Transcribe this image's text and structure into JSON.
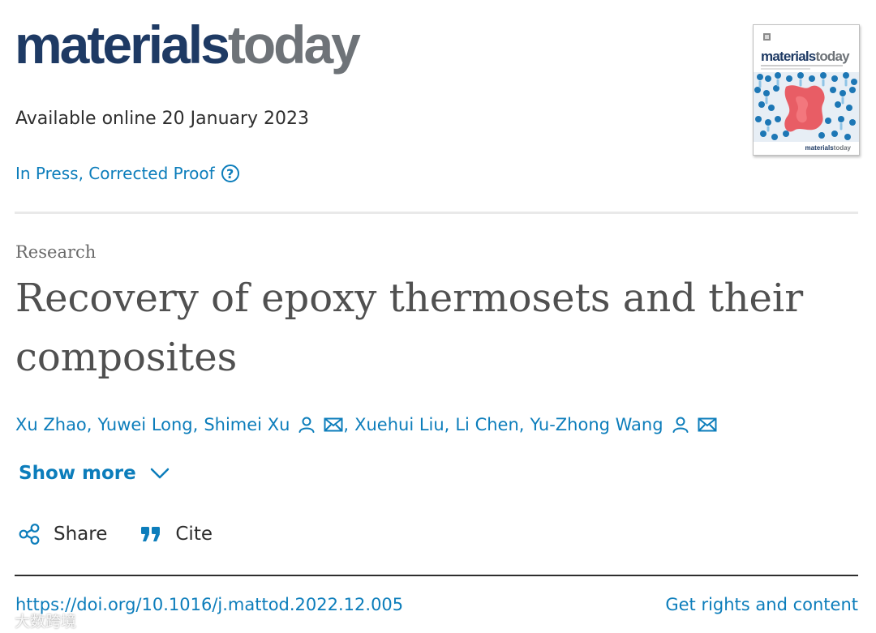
{
  "header": {
    "logo_part1": "materials",
    "logo_part2": "today",
    "available_online": "Available online 20 January 2023",
    "status": "In Press, Corrected Proof",
    "help_symbol": "?"
  },
  "cover": {
    "title_part1": "materials",
    "title_part2": "today",
    "footer_part1": "materials",
    "footer_part2": "today"
  },
  "article": {
    "type": "Research",
    "title_line1": "Recovery of epoxy thermosets and their",
    "title_line2": "composites",
    "authors": [
      {
        "name": "Xu Zhao",
        "corresponding": false
      },
      {
        "name": "Yuwei Long",
        "corresponding": false
      },
      {
        "name": "Shimei Xu",
        "corresponding": true
      },
      {
        "name": "Xuehui Liu",
        "corresponding": false
      },
      {
        "name": "Li Chen",
        "corresponding": false
      },
      {
        "name": "Yu-Zhong Wang",
        "corresponding": true
      }
    ],
    "separator": ","
  },
  "controls": {
    "show_more": "Show more",
    "share": "Share",
    "cite": "Cite"
  },
  "footer": {
    "doi": "https://doi.org/10.1016/j.mattod.2022.12.005",
    "rights": "Get rights and content"
  },
  "watermark": "大数跨境",
  "colors": {
    "link": "#0c7dbb",
    "logo_navy": "#1e3a64",
    "logo_gray": "#6e7378",
    "title": "#505050"
  },
  "icons": [
    "help-icon",
    "person-icon",
    "envelope-icon",
    "chevron-down-icon",
    "share-icon",
    "quote-icon"
  ]
}
